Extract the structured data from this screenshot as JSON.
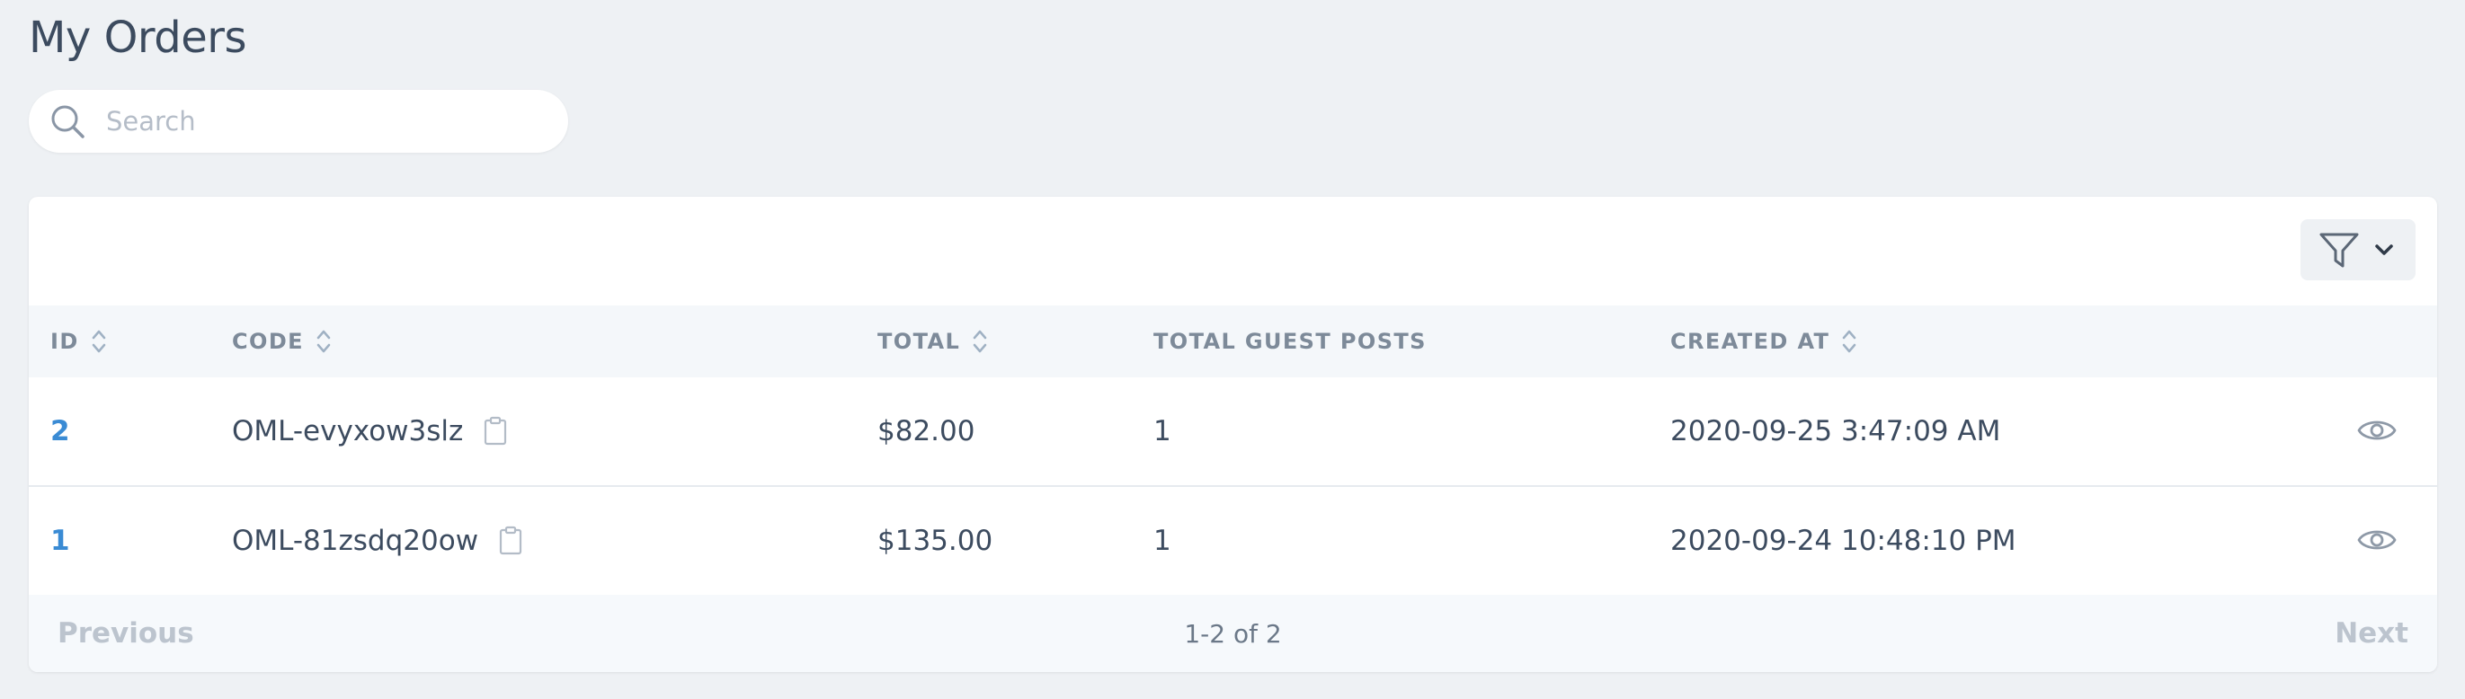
{
  "page": {
    "title": "My Orders"
  },
  "search": {
    "placeholder": "Search",
    "value": ""
  },
  "table": {
    "columns": [
      {
        "key": "id",
        "label": "ID",
        "sortable": true
      },
      {
        "key": "code",
        "label": "CODE",
        "sortable": true
      },
      {
        "key": "total",
        "label": "TOTAL",
        "sortable": true
      },
      {
        "key": "guest_posts",
        "label": "TOTAL GUEST POSTS",
        "sortable": false
      },
      {
        "key": "created_at",
        "label": "CREATED AT",
        "sortable": true
      }
    ],
    "rows": [
      {
        "id": "2",
        "code": "OML-evyxow3slz",
        "total": "$82.00",
        "guest_posts": "1",
        "created_at": "2020-09-25 3:47:09 AM"
      },
      {
        "id": "1",
        "code": "OML-81zsdq20ow",
        "total": "$135.00",
        "guest_posts": "1",
        "created_at": "2020-09-24 10:48:10 PM"
      }
    ]
  },
  "pagination": {
    "previous": "Previous",
    "next": "Next",
    "count": "1-2 of 2"
  },
  "icons": {
    "search": "search-icon",
    "filter": "funnel-icon",
    "dropdown": "chevron-down-icon",
    "sort": "sort-icon",
    "copy": "clipboard-icon",
    "view": "eye-icon"
  },
  "colors": {
    "background": "#eef1f4",
    "link": "#3a8bd4",
    "header_text": "#7d8a99",
    "text": "#3c4b5f",
    "disabled": "#bcc4ce"
  }
}
